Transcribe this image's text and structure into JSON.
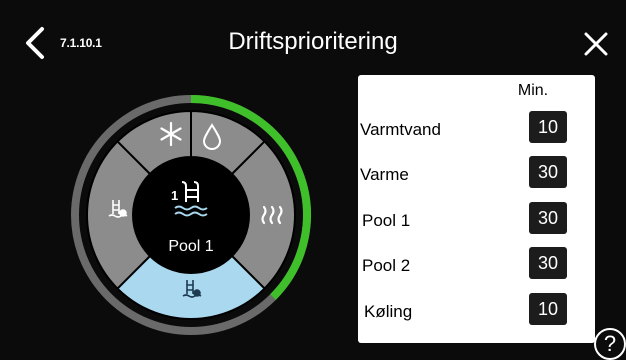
{
  "header": {
    "menu_code": "7.1.10.1",
    "title": "Driftsprioritering"
  },
  "wheel": {
    "center_label": "Pool 1",
    "active_segment": "pool",
    "progress_fraction": 0.375,
    "colors": {
      "segment": "#8c8c8c",
      "active_segment": "#a9d8ef",
      "center": "#000000",
      "ring_progress": "#3fbf2a",
      "ring_track": "#6a6a6a"
    },
    "segment_icons": [
      "snowflake-icon",
      "water-drop-icon",
      "heating-wave-icon",
      "pool-icon",
      "pool-icon",
      "pool-icon"
    ]
  },
  "panel": {
    "column_header": "Min.",
    "rows": [
      {
        "label": "Varmtvand",
        "value": "10"
      },
      {
        "label": "Varme",
        "value": "30"
      },
      {
        "label": "Pool 1",
        "value": "30"
      },
      {
        "label": "Pool 2",
        "value": "30"
      },
      {
        "label": "Køling",
        "value": "10"
      }
    ]
  },
  "help": {
    "label": "?"
  }
}
